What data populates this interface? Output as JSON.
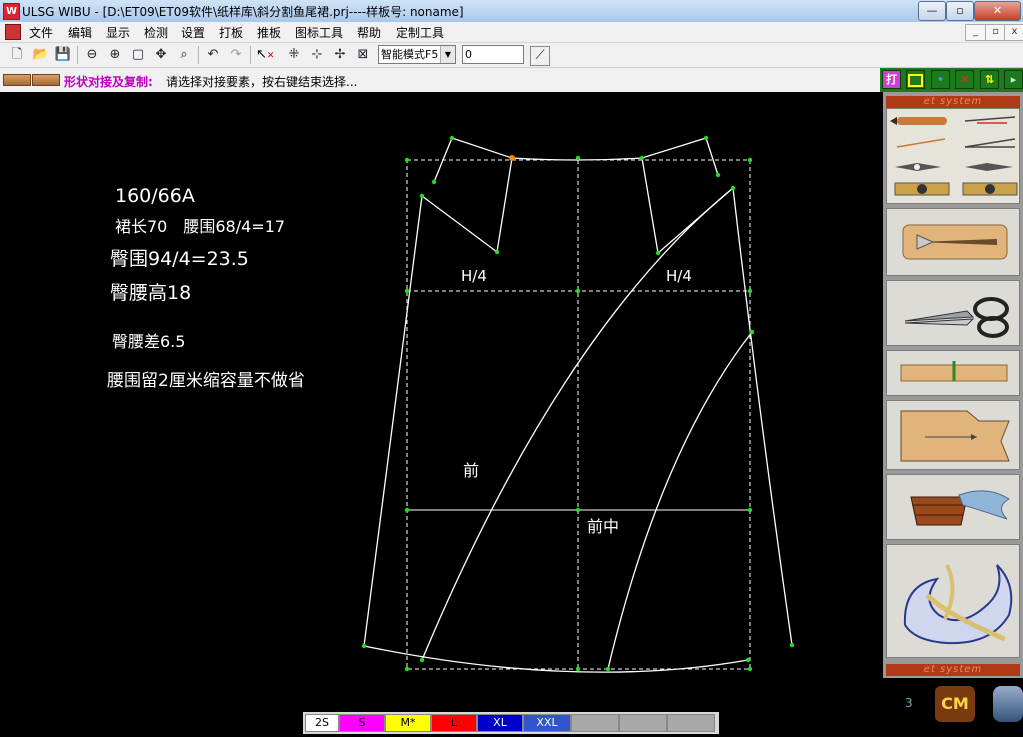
{
  "window": {
    "title": "ULSG WIBU - [D:\\ET09\\ET09软件\\纸样库\\斜分割鱼尾裙.prj----样板号: noname]",
    "minimize": "—",
    "maximize": "▫",
    "close": "✕"
  },
  "menu": {
    "items": [
      "文件",
      "编辑",
      "显示",
      "检测",
      "设置",
      "打板",
      "推板",
      "图标工具",
      "帮助",
      "定制工具"
    ],
    "mdi_minimize": "_",
    "mdi_restore": "▫",
    "mdi_close": "x"
  },
  "toolbar": {
    "mode_select": "智能模式F5",
    "value_input": "0",
    "icons": [
      "new-icon",
      "open-icon",
      "save-icon",
      "zoom-out-icon",
      "zoom-in-icon",
      "fit-page-icon",
      "pan-icon",
      "zoom-window-icon",
      "undo-icon",
      "redo-icon",
      "select-delete-icon",
      "point-snap-icon",
      "point-move-icon",
      "point-add-icon",
      "point-delete-icon",
      "measure-icon"
    ]
  },
  "status": {
    "mode_title": "形状对接及复制:",
    "hint": "请选择对接要素，按右键结束选择..."
  },
  "side_buttons": {
    "draft": "打",
    "rect": "",
    "dot": "•",
    "cross": "✕",
    "arrows": "⇅"
  },
  "side_panel": {
    "header_top": "et system",
    "header_bottom": "et system"
  },
  "notes": {
    "size": "160/66A",
    "skirt": "裙长70　腰围68/4=17",
    "hip": "臀围94/4=23.5",
    "hip_height": "臀腰高18",
    "hip_waist_diff": "臀腰差6.5",
    "waist_note": "腰围留2厘米缩容量不做省"
  },
  "pattern_labels": {
    "h4_left": "H/4",
    "h4_right": "H/4",
    "front": "前",
    "center_front": "前中"
  },
  "sizes": [
    {
      "label": "2S",
      "color": "#ffffff"
    },
    {
      "label": "S",
      "color": "#ff00ff"
    },
    {
      "label": "M*",
      "color": "#ffff00"
    },
    {
      "label": "L",
      "color": "#ff0000"
    },
    {
      "label": "XL",
      "color": "#0000cc"
    },
    {
      "label": "XXL",
      "color": "#3355cc"
    },
    {
      "label": "",
      "color": "#a8a8a8"
    },
    {
      "label": "",
      "color": "#a8a8a8"
    },
    {
      "label": "",
      "color": "#a8a8a8"
    }
  ],
  "bottom_corner": {
    "number": "3",
    "cm_badge": "CM"
  },
  "colors": {
    "accent_green": "#1b7a1b",
    "status_title": "#c000c0",
    "pattern_line": "#ffffff",
    "guide_line": "#ffffff",
    "point": "#22dd22",
    "point_selected": "#ff8800"
  }
}
